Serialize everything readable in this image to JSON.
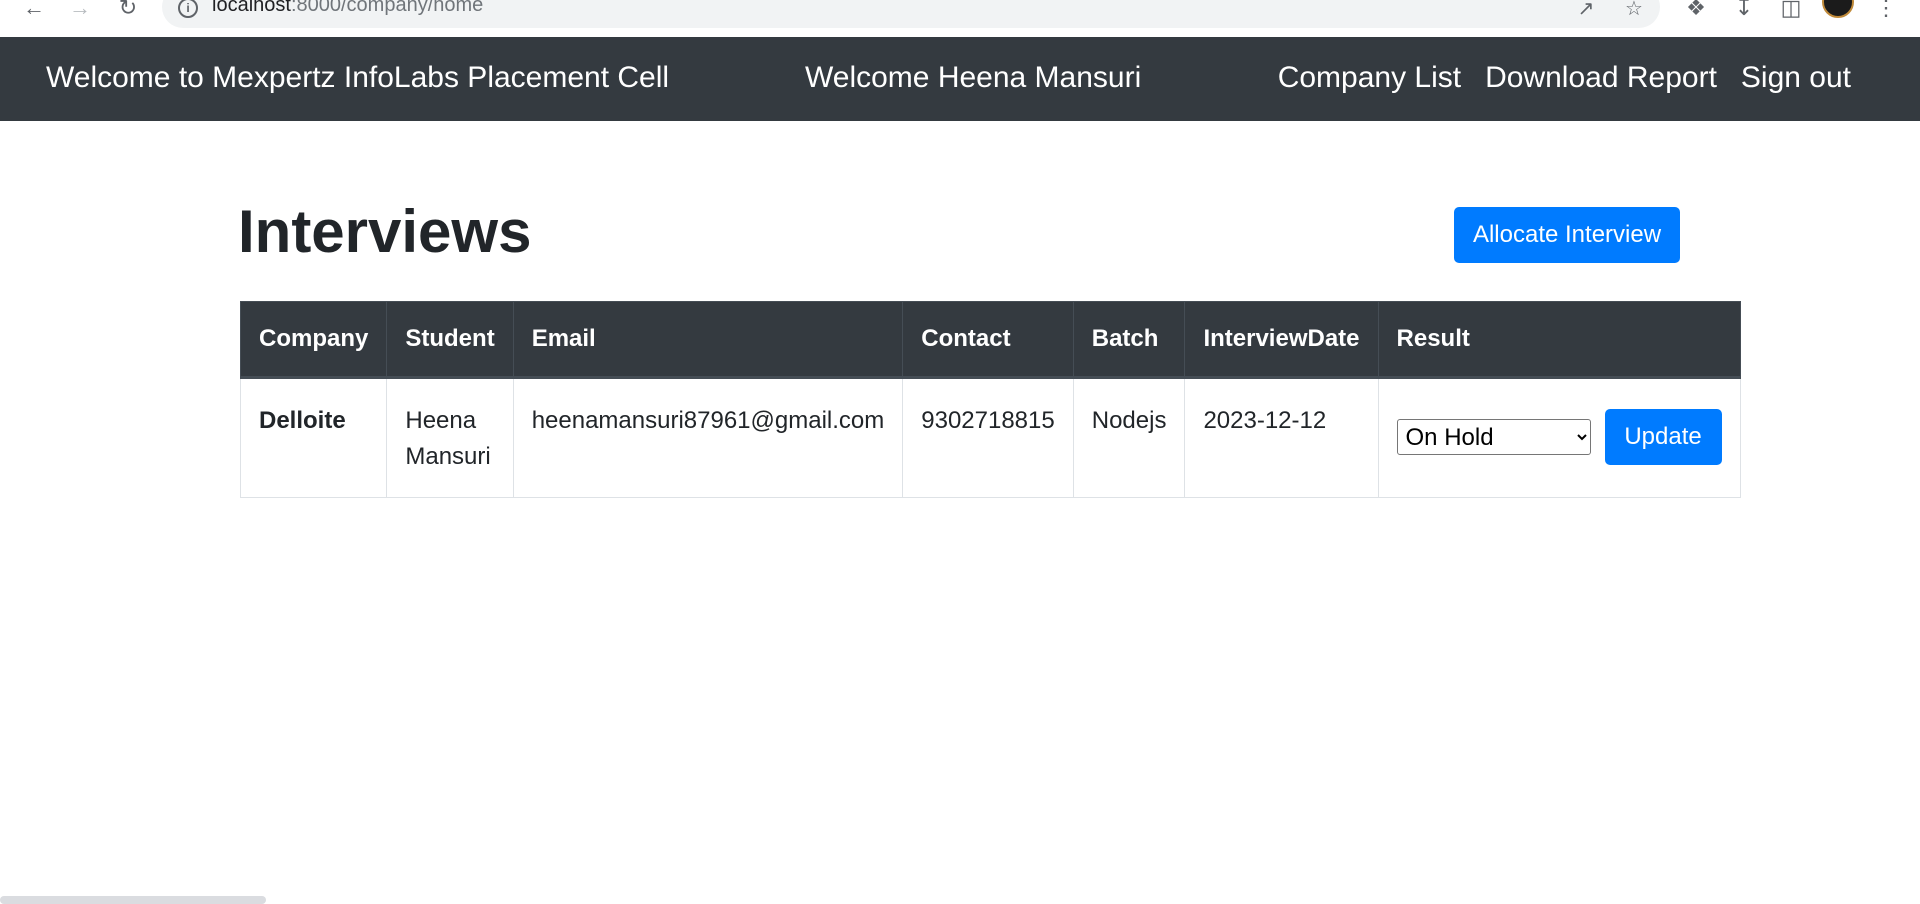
{
  "browser": {
    "url_host": "localhost",
    "url_rest": ":8000/company/home"
  },
  "navbar": {
    "brand": "Welcome to Mexpertz InfoLabs Placement Cell",
    "welcome": "Welcome Heena Mansuri",
    "links": [
      "Company List",
      "Download Report",
      "Sign out"
    ]
  },
  "main": {
    "title": "Interviews",
    "allocate_button": "Allocate Interview",
    "table": {
      "headers": [
        "Company",
        "Student",
        "Email",
        "Contact",
        "Batch",
        "InterviewDate",
        "Result"
      ],
      "rows": [
        {
          "company": "Delloite",
          "student": "Heena Mansuri",
          "email": "heenamansuri87961@gmail.com",
          "contact": "9302718815",
          "batch": "Nodejs",
          "interview_date": "2023-12-12",
          "result": "On Hold",
          "update_label": "Update"
        }
      ]
    }
  },
  "colors": {
    "navbar_bg": "#343a40",
    "primary": "#007bff"
  }
}
